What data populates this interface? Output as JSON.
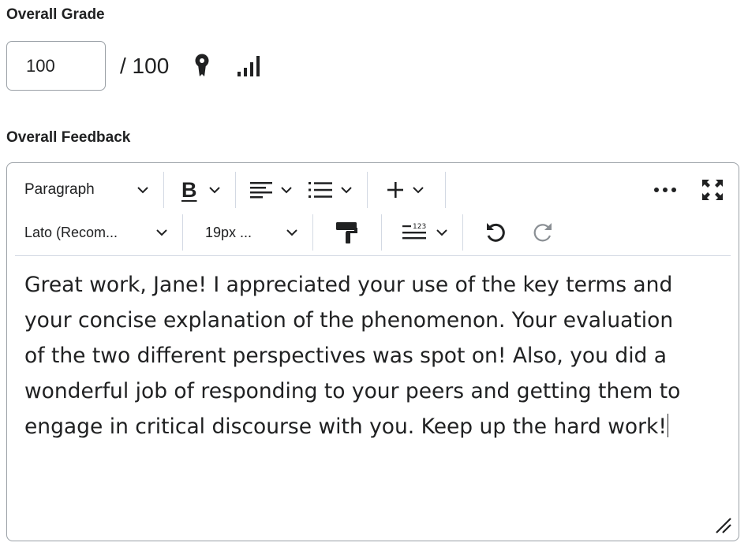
{
  "grade": {
    "label": "Overall Grade",
    "value": "100",
    "out_of": "/ 100",
    "rubric_icon": "rubric-icon",
    "stats_icon": "stats-icon"
  },
  "feedback": {
    "label": "Overall Feedback",
    "toolbar": {
      "format_label": "Paragraph",
      "bold_label": "B",
      "align_icon": "align-left-icon",
      "list_icon": "bullet-list-icon",
      "insert_icon": "plus-icon",
      "more_icon": "more-icon",
      "fullscreen_icon": "fullscreen-icon",
      "font_label": "Lato (Recom...",
      "size_label": "19px ...",
      "format_painter_icon": "paint-roller-icon",
      "line_spacing_icon": "line-spacing-icon",
      "undo_icon": "undo-icon",
      "redo_icon": "redo-icon"
    },
    "text_lines": [
      "Great work, Jane! I appreciated your use of the key terms and",
      "your concise explanation of the phenomenon.  Your evaluation",
      "of the two different perspectives was spot on! Also, you did a",
      "wonderful job of responding to your peers and getting them to",
      "engage in critical discourse with you.  Keep up the hard work!"
    ]
  },
  "colors": {
    "text": "#202122",
    "border": "#9aa0a6",
    "divider": "#d3d9e3",
    "disabled": "#8a8f94"
  }
}
